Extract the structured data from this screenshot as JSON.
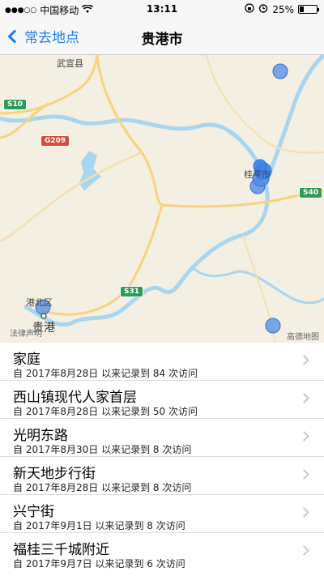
{
  "status_bar": {
    "signal": "●●●○○",
    "carrier": "中国移动",
    "wifi_icon": "wifi-icon",
    "time": "13:11",
    "battery": "25%",
    "battery_level": 0.25
  },
  "nav": {
    "back_label": "常去地点",
    "title": "贵港市"
  },
  "map": {
    "labels": {
      "wuxuan": "武宣县",
      "city": "桂平市",
      "gangbei": "港北区",
      "guigang": "贵港",
      "legal": "法律声明",
      "provider": "高德地图"
    },
    "shields": {
      "s10": "S10",
      "g209": "G209",
      "s40": "S40",
      "s31": "S31"
    },
    "colors": {
      "land": "#f4efe3",
      "water": "#a9d6ef",
      "road": "#f7d37a",
      "marker": "#4f8ce8"
    }
  },
  "places": [
    {
      "name": "家庭",
      "detail": "自 2017年8月28日 以来记录到 84 次访问"
    },
    {
      "name": "西山镇现代人家首层",
      "detail": "自 2017年8月28日 以来记录到 50 次访问"
    },
    {
      "name": "光明东路",
      "detail": "自 2017年8月30日 以来记录到 8 次访问"
    },
    {
      "name": "新天地步行街",
      "detail": "自 2017年8月28日 以来记录到 8 次访问"
    },
    {
      "name": "兴宁街",
      "detail": "自 2017年9月1日 以来记录到 8 次访问"
    },
    {
      "name": "福桂三千城附近",
      "detail": "自 2017年9月7日 以来记录到 6 次访问"
    }
  ]
}
